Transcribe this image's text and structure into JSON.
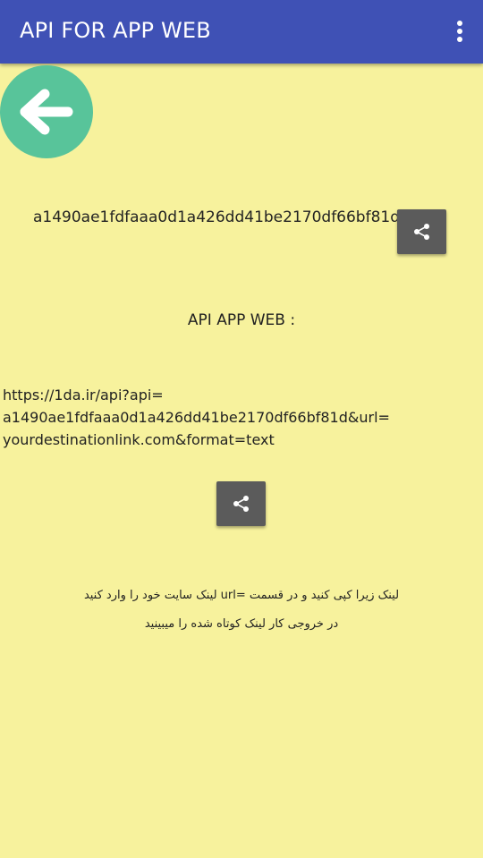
{
  "app_bar": {
    "title": "API FOR APP WEB",
    "menu_icon": "more-vertical-icon"
  },
  "back_button": {
    "icon": "arrow-left-icon",
    "color": "#58c49a"
  },
  "api_key": {
    "value": "a1490ae1fdfaaa0d1a426dd41be2170df66bf81d",
    "share_icon": "share-icon"
  },
  "section": {
    "label": "API APP WEB :"
  },
  "api_url": {
    "line1": "https://1da.ir/api?api=",
    "line2": "a1490ae1fdfaaa0d1a426dd41be2170df66bf81d&url=",
    "line3": "yourdestinationlink.com&format=text",
    "share_icon": "share-icon"
  },
  "instructions": {
    "line1": "لینک زیرا کپی کنید و در قسمت =url لینک سایت خود را وارد کنید",
    "line2": "در خروجی کار لینک کوتاه شده را میبینید"
  },
  "colors": {
    "app_bar": "#3f51b5",
    "background": "#f7f29d",
    "share_button": "#5b5b5b"
  }
}
